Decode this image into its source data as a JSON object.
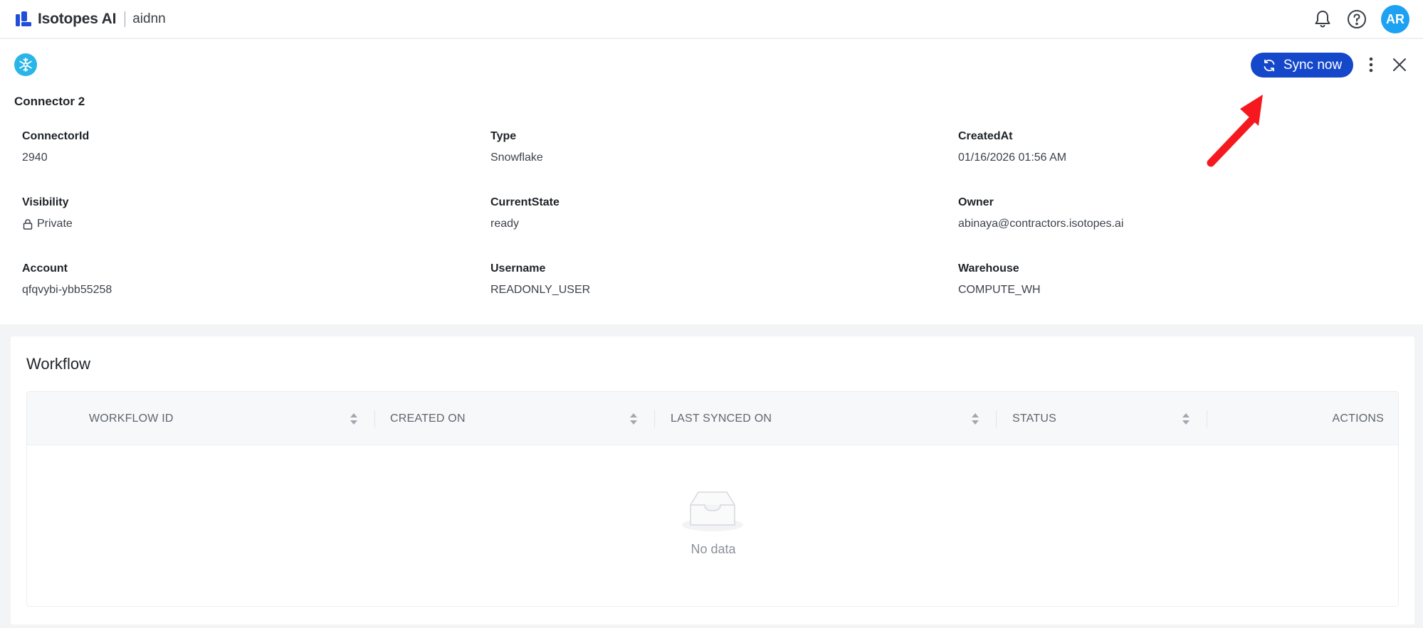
{
  "header": {
    "brand": "Isotopes AI",
    "workspace": "aidnn",
    "avatar_initials": "AR",
    "icons": [
      "bell-icon",
      "help-icon"
    ]
  },
  "connector": {
    "name": "Connector 2",
    "icon": "snowflake-icon",
    "sync_label": "Sync now",
    "fields": {
      "connector_id": {
        "label": "ConnectorId",
        "value": "2940"
      },
      "type": {
        "label": "Type",
        "value": "Snowflake"
      },
      "created_at": {
        "label": "CreatedAt",
        "value": "01/16/2026 01:56 AM"
      },
      "visibility": {
        "label": "Visibility",
        "value": "Private",
        "icon": "lock-icon"
      },
      "current_state": {
        "label": "CurrentState",
        "value": "ready"
      },
      "owner": {
        "label": "Owner",
        "value": "abinaya@contractors.isotopes.ai"
      },
      "account": {
        "label": "Account",
        "value": "qfqvybi-ybb55258"
      },
      "username": {
        "label": "Username",
        "value": "READONLY_USER"
      },
      "warehouse": {
        "label": "Warehouse",
        "value": "COMPUTE_WH"
      }
    }
  },
  "workflow": {
    "title": "Workflow",
    "columns": [
      "WORKFLOW ID",
      "CREATED ON",
      "LAST SYNCED ON",
      "STATUS",
      "ACTIONS"
    ],
    "rows": [],
    "empty_text": "No data"
  },
  "colors": {
    "primary": "#1447c9",
    "avatar": "#1da1f2",
    "snowflake": "#29b5e8",
    "annotation_arrow": "#f5191f"
  }
}
